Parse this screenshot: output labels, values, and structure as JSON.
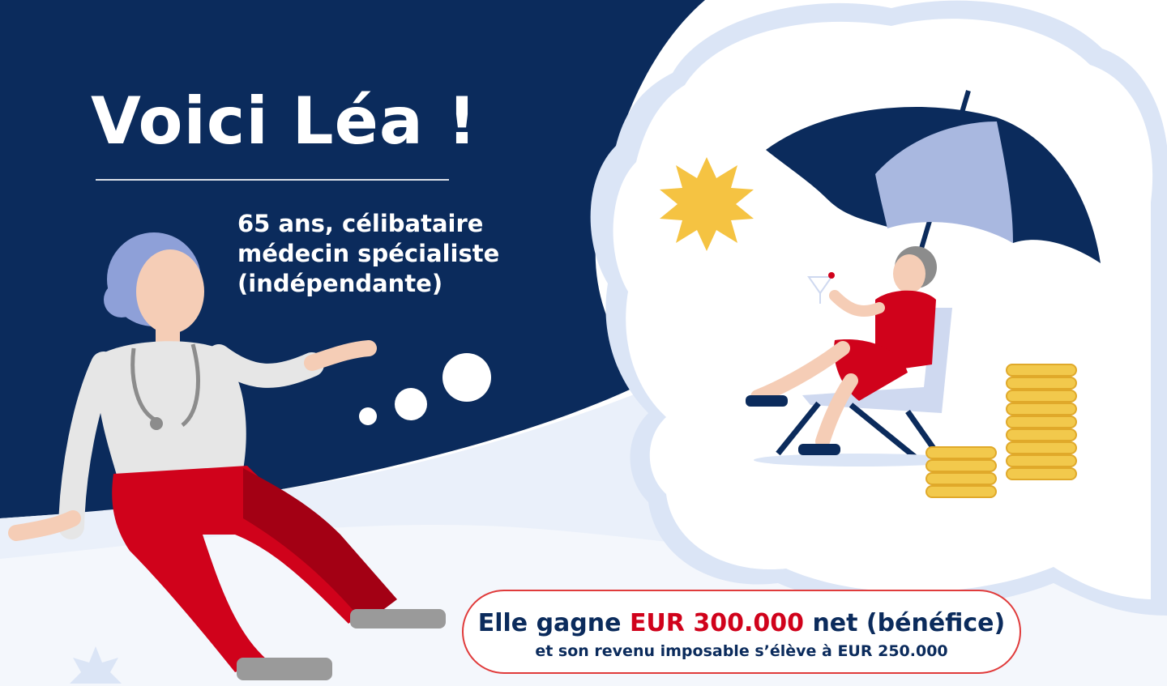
{
  "header": {
    "title": "Voici Léa !",
    "bio_lines": [
      "65 ans, célibataire",
      "médecin spécialiste",
      "(indépendante)"
    ]
  },
  "income": {
    "prefix": "Elle gagne",
    "amount": "EUR 300.000",
    "suffix": "net (bénéfice)",
    "detail": "et son revenu imposable s’élève à EUR 250.000"
  },
  "colors": {
    "navy": "#0b2b5c",
    "light_blue": "#e8eef9",
    "red": "#d0021b",
    "gold": "#f2c94c",
    "periwinkle": "#a9b8e0"
  },
  "icons": [
    "doctor-woman-illustration",
    "thought-bubble",
    "sun-icon",
    "umbrella-icon",
    "beach-chair-woman-illustration",
    "coin-stack-icon"
  ]
}
